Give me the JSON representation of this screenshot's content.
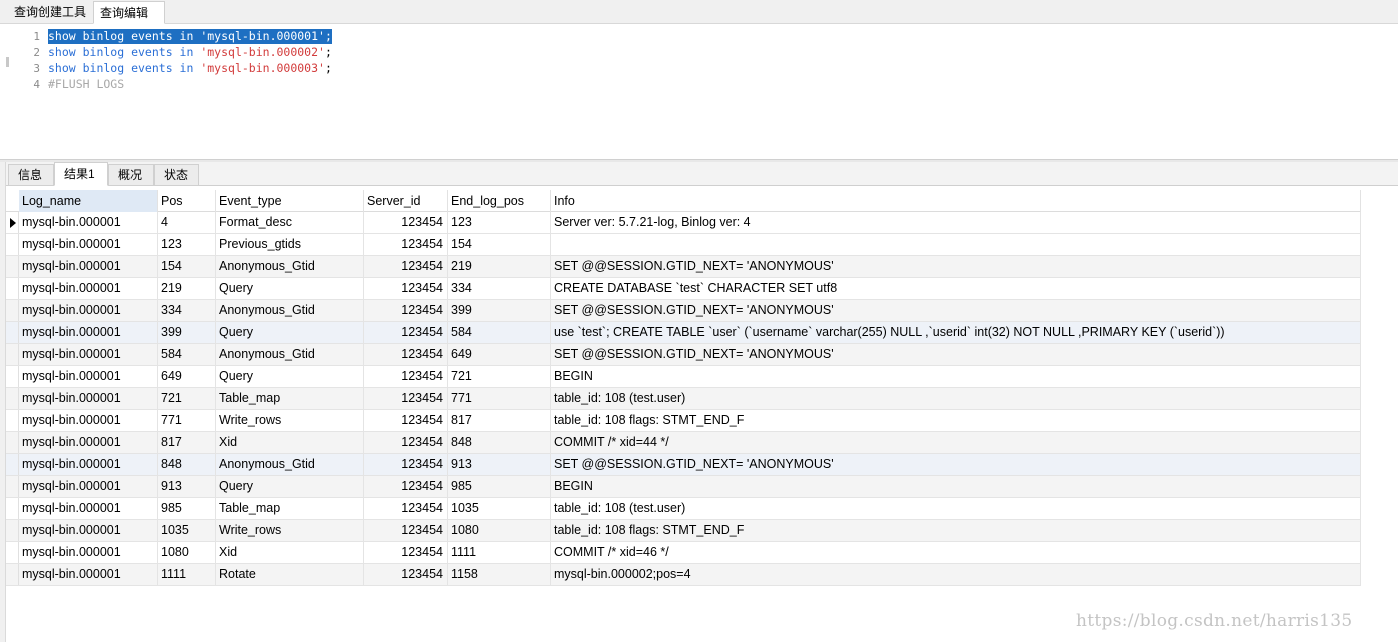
{
  "top_tabs": [
    "查询创建工具",
    "查询编辑器"
  ],
  "editor": {
    "lines": [
      {
        "no": "1",
        "keyword": "show binlog events in ",
        "string": "'mysql-bin.000001'",
        "punct": ";"
      },
      {
        "no": "2",
        "keyword": "show binlog events in ",
        "string": "'mysql-bin.000002'",
        "punct": ";"
      },
      {
        "no": "3",
        "keyword": "show binlog events in ",
        "string": "'mysql-bin.000003'",
        "punct": ";"
      },
      {
        "no": "4",
        "comment": "#FLUSH LOGS"
      }
    ]
  },
  "result_tabs": [
    "信息",
    "结果1",
    "概况",
    "状态"
  ],
  "table": {
    "columns": [
      "Log_name",
      "Pos",
      "Event_type",
      "Server_id",
      "End_log_pos",
      "Info"
    ],
    "rows": [
      [
        "mysql-bin.000001",
        "4",
        "Format_desc",
        "123454",
        "123",
        "Server ver: 5.7.21-log, Binlog ver: 4"
      ],
      [
        "mysql-bin.000001",
        "123",
        "Previous_gtids",
        "123454",
        "154",
        ""
      ],
      [
        "mysql-bin.000001",
        "154",
        "Anonymous_Gtid",
        "123454",
        "219",
        "SET @@SESSION.GTID_NEXT= 'ANONYMOUS'"
      ],
      [
        "mysql-bin.000001",
        "219",
        "Query",
        "123454",
        "334",
        "CREATE DATABASE `test` CHARACTER SET utf8"
      ],
      [
        "mysql-bin.000001",
        "334",
        "Anonymous_Gtid",
        "123454",
        "399",
        "SET @@SESSION.GTID_NEXT= 'ANONYMOUS'"
      ],
      [
        "mysql-bin.000001",
        "399",
        "Query",
        "123454",
        "584",
        "use `test`; CREATE TABLE `user` (`username`  varchar(255) NULL ,`userid`  int(32) NOT NULL ,PRIMARY KEY (`userid`))"
      ],
      [
        "mysql-bin.000001",
        "584",
        "Anonymous_Gtid",
        "123454",
        "649",
        "SET @@SESSION.GTID_NEXT= 'ANONYMOUS'"
      ],
      [
        "mysql-bin.000001",
        "649",
        "Query",
        "123454",
        "721",
        "BEGIN"
      ],
      [
        "mysql-bin.000001",
        "721",
        "Table_map",
        "123454",
        "771",
        "table_id: 108 (test.user)"
      ],
      [
        "mysql-bin.000001",
        "771",
        "Write_rows",
        "123454",
        "817",
        "table_id: 108 flags: STMT_END_F"
      ],
      [
        "mysql-bin.000001",
        "817",
        "Xid",
        "123454",
        "848",
        "COMMIT /* xid=44 */"
      ],
      [
        "mysql-bin.000001",
        "848",
        "Anonymous_Gtid",
        "123454",
        "913",
        "SET @@SESSION.GTID_NEXT= 'ANONYMOUS'"
      ],
      [
        "mysql-bin.000001",
        "913",
        "Query",
        "123454",
        "985",
        "BEGIN"
      ],
      [
        "mysql-bin.000001",
        "985",
        "Table_map",
        "123454",
        "1035",
        "table_id: 108 (test.user)"
      ],
      [
        "mysql-bin.000001",
        "1035",
        "Write_rows",
        "123454",
        "1080",
        "table_id: 108 flags: STMT_END_F"
      ],
      [
        "mysql-bin.000001",
        "1080",
        "Xid",
        "123454",
        "1111",
        "COMMIT /* xid=46 */"
      ],
      [
        "mysql-bin.000001",
        "1111",
        "Rotate",
        "123454",
        "1158",
        "mysql-bin.000002;pos=4"
      ]
    ]
  },
  "watermark": "https://blog.csdn.net/harris135"
}
